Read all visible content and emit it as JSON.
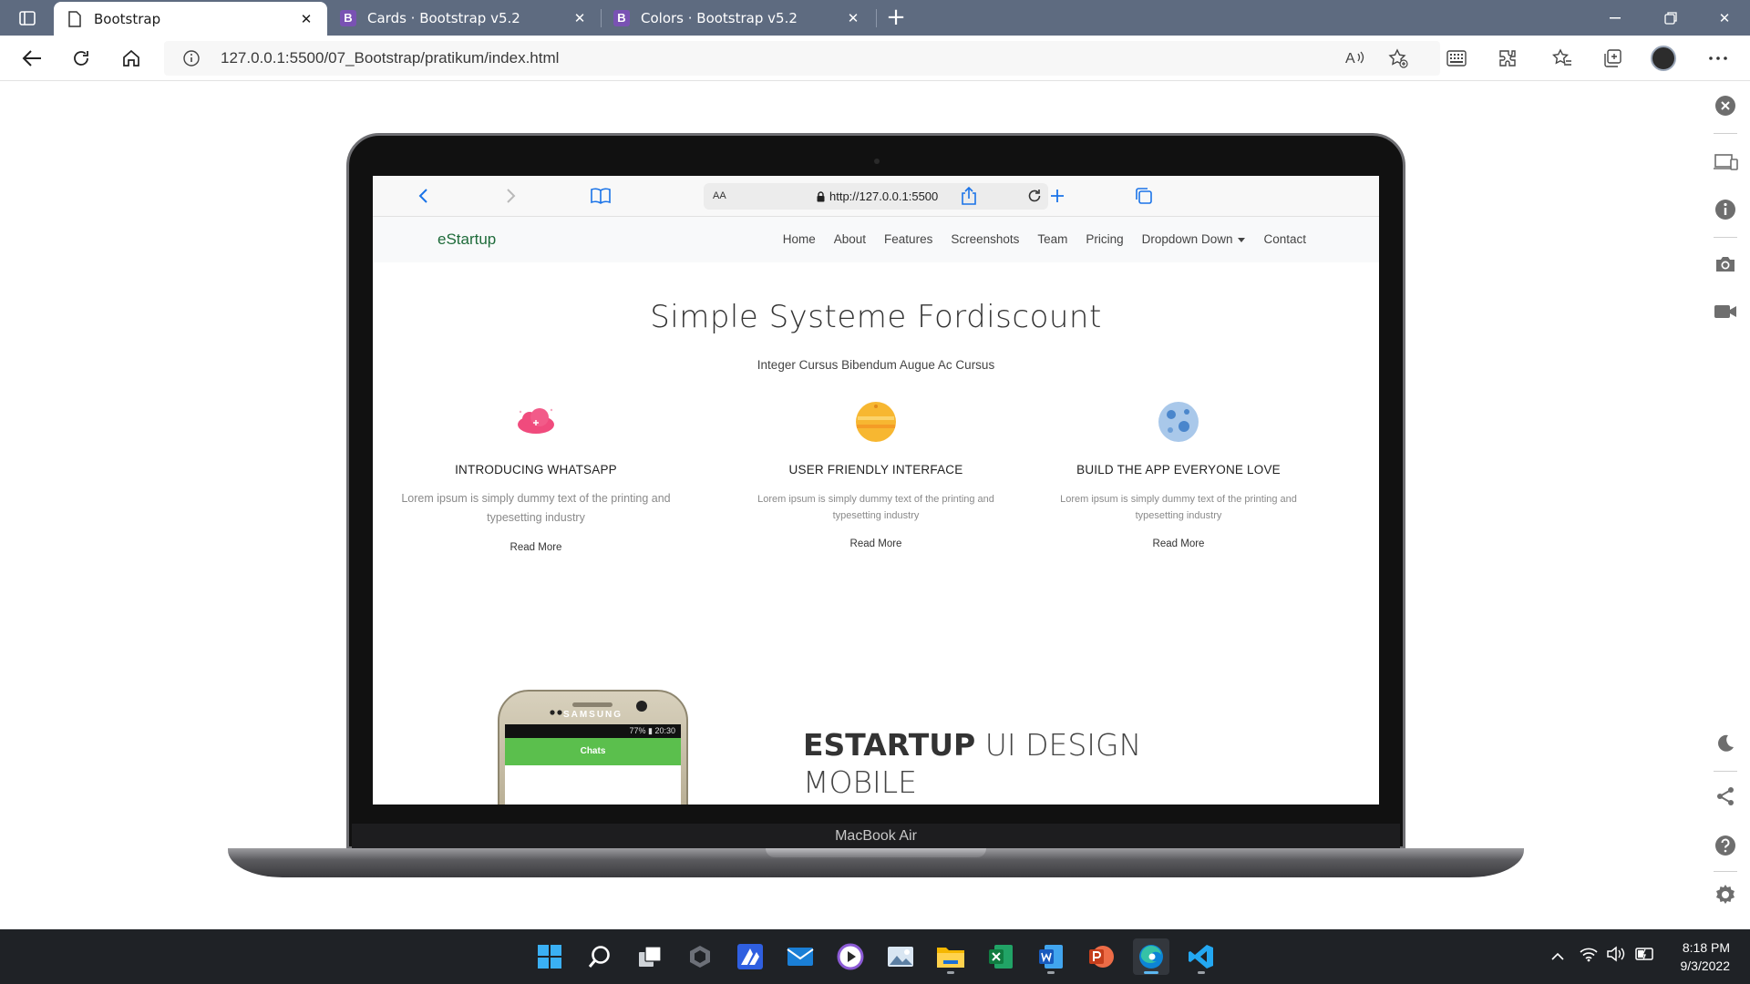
{
  "browser": {
    "tabs": [
      {
        "title": "Bootstrap",
        "active": true
      },
      {
        "title": "Cards · Bootstrap v5.2",
        "active": false
      },
      {
        "title": "Colors · Bootstrap v5.2",
        "active": false
      }
    ],
    "address": "127.0.0.1:5500/07_Bootstrap/pratikum/index.html"
  },
  "device": {
    "label": "MacBook Air",
    "safari": {
      "text_size": "AA",
      "url": "http://127.0.0.1:5500"
    }
  },
  "site": {
    "brand": "eStartup",
    "menu": [
      "Home",
      "About",
      "Features",
      "Screenshots",
      "Team",
      "Pricing",
      "Dropdown Down",
      "Contact"
    ],
    "hero": {
      "title": "Simple Systeme Fordiscount",
      "subtitle": "Integer Cursus Bibendum Augue Ac Cursus"
    },
    "features": [
      {
        "title": "INTRODUCING WHATSAPP",
        "desc": "Lorem ipsum is simply dummy text of the printing and typesetting industry",
        "more": "Read More",
        "icon": "pink-cloud-icon"
      },
      {
        "title": "USER FRIENDLY INTERFACE",
        "desc": "Lorem ipsum is simply dummy text of the printing and typesetting industry",
        "more": "Read More",
        "icon": "orange-planet-icon"
      },
      {
        "title": "BUILD THE APP EVERYONE LOVE",
        "desc": "Lorem ipsum is simply dummy text of the printing and typesetting industry",
        "more": "Read More",
        "icon": "blue-planet-icon"
      }
    ],
    "promo": {
      "bold": "ESTARTUP",
      "rest": " UI DESIGN",
      "line2": "MOBILE"
    },
    "phone": {
      "brand": "SAMSUNG",
      "status": "77% ▮ 20:30",
      "app_title": "Chats"
    }
  },
  "taskbar": {
    "time": "8:18 PM",
    "date": "9/3/2022"
  },
  "colors": {
    "tabbar": "#5e6b80",
    "brand_green": "#1e6b3a",
    "ios_blue": "#1a73e8",
    "bootstrap_purple": "#7952b3"
  }
}
